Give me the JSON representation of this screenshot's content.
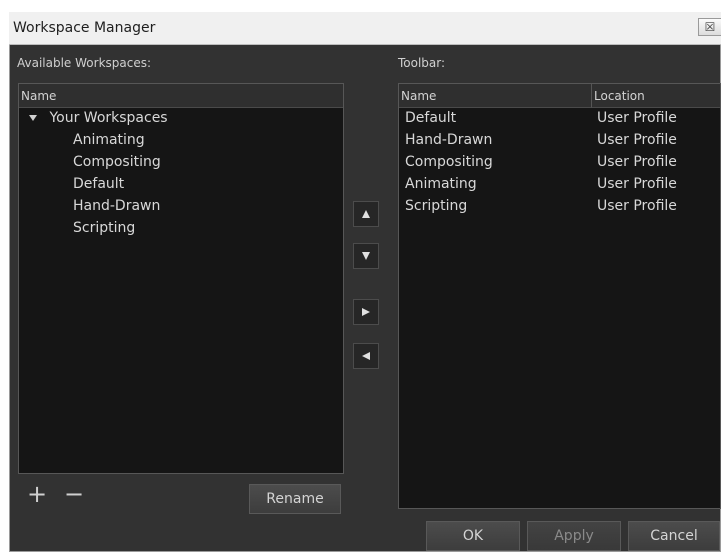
{
  "window": {
    "title": "Workspace Manager",
    "close_symbol": "☒"
  },
  "left": {
    "label": "Available Workspaces:",
    "column_name": "Name",
    "group_label": "Your Workspaces",
    "items": [
      "Animating",
      "Compositing",
      "Default",
      "Hand-Drawn",
      "Scripting"
    ]
  },
  "right": {
    "label": "Toolbar:",
    "columns": {
      "name": "Name",
      "location": "Location"
    },
    "rows": [
      {
        "name": "Default",
        "location": "User Profile"
      },
      {
        "name": "Hand-Drawn",
        "location": "User Profile"
      },
      {
        "name": "Compositing",
        "location": "User Profile"
      },
      {
        "name": "Animating",
        "location": "User Profile"
      },
      {
        "name": "Scripting",
        "location": "User Profile"
      }
    ]
  },
  "buttons": {
    "add": "+",
    "remove": "−",
    "rename": "Rename",
    "ok": "OK",
    "apply": "Apply",
    "cancel": "Cancel"
  },
  "icons": {
    "close": "close-icon",
    "tree": "triangle-down-icon",
    "up": "triangle-up-icon",
    "down": "triangle-down-icon",
    "right": "triangle-right-icon",
    "left": "triangle-left-icon"
  },
  "colors": {
    "window_bg": "#323232",
    "panel_bg": "#151515",
    "text": "#d8d8d8",
    "title_bar": "#f0f0f0"
  }
}
